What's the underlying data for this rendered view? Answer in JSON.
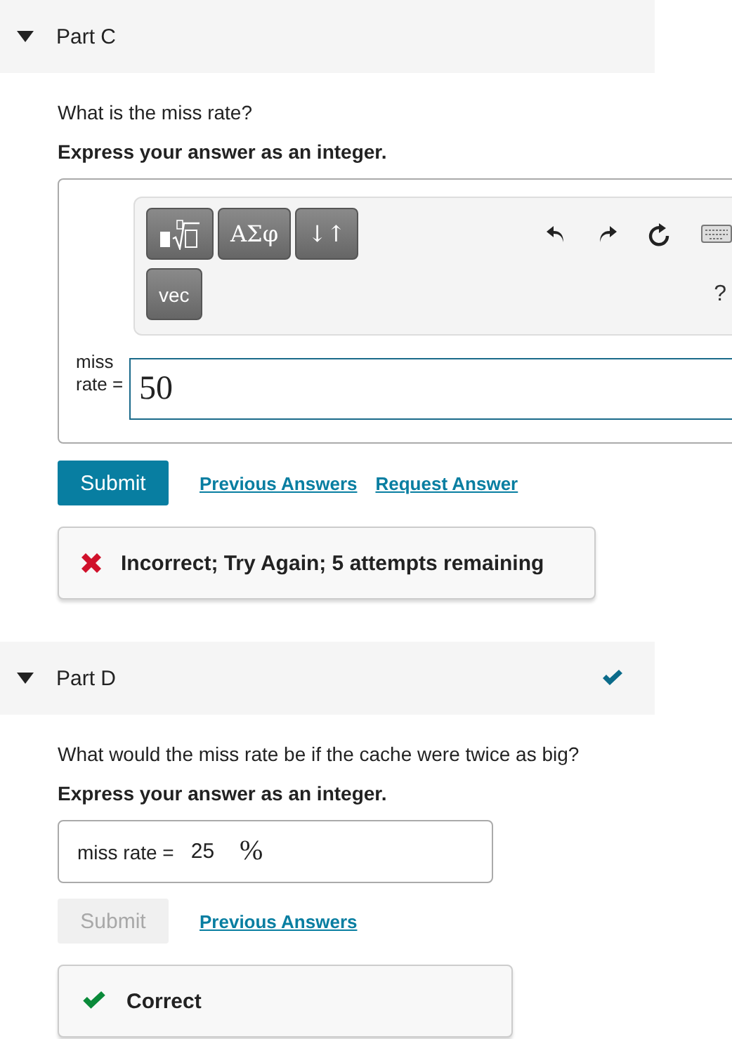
{
  "parts": [
    {
      "title": "Part C",
      "expanded": true,
      "completed": false,
      "question": "What is the miss rate?",
      "instruction": "Express your answer as an integer.",
      "answer": {
        "kind": "math",
        "label": "miss rate =",
        "value": "50",
        "toolbar": {
          "buttons": [
            "ΑΣφ",
            "↓↑"
          ],
          "second_row": "vec",
          "help": "?"
        }
      },
      "submit": {
        "label": "Submit",
        "disabled": false
      },
      "links": [
        "Previous Answers",
        "Request Answer"
      ],
      "feedback": {
        "kind": "incorrect",
        "text": "Incorrect; Try Again; 5 attempts remaining"
      }
    },
    {
      "title": "Part D",
      "expanded": true,
      "completed": true,
      "question": "What would the miss rate be if the cache were twice as big?",
      "instruction": "Express your answer as an integer.",
      "answer": {
        "kind": "inline",
        "label": "miss rate =",
        "value": "25",
        "unit": "%"
      },
      "submit": {
        "label": "Submit",
        "disabled": true
      },
      "links": [
        "Previous Answers"
      ],
      "feedback": {
        "kind": "correct",
        "text": "Correct"
      }
    }
  ]
}
